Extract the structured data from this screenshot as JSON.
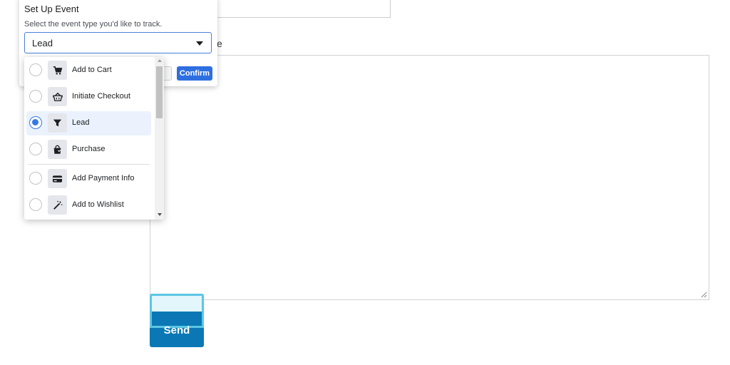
{
  "background": {
    "label_fragment": "e",
    "send_label": "Send"
  },
  "panel": {
    "title": "Set Up Event",
    "subtitle": "Select the event type you'd like to track.",
    "selected_value": "Lead",
    "confirm_label": "Confirm"
  },
  "dropdown": {
    "options": [
      {
        "label": "Add to Cart",
        "icon": "cart-icon",
        "selected": false
      },
      {
        "label": "Initiate Checkout",
        "icon": "basket-icon",
        "selected": false
      },
      {
        "label": "Lead",
        "icon": "funnel-icon",
        "selected": true
      },
      {
        "label": "Purchase",
        "icon": "shopping-bag-icon",
        "selected": false
      },
      {
        "label": "Add Payment Info",
        "icon": "credit-card-icon",
        "selected": false
      },
      {
        "label": "Add to Wishlist",
        "icon": "magic-wand-icon",
        "selected": false
      }
    ]
  },
  "colors": {
    "accent": "#3578e5",
    "confirm": "#2e6fe0",
    "send_button": "#0b78b5",
    "focus_ring": "#5bc6e3"
  }
}
